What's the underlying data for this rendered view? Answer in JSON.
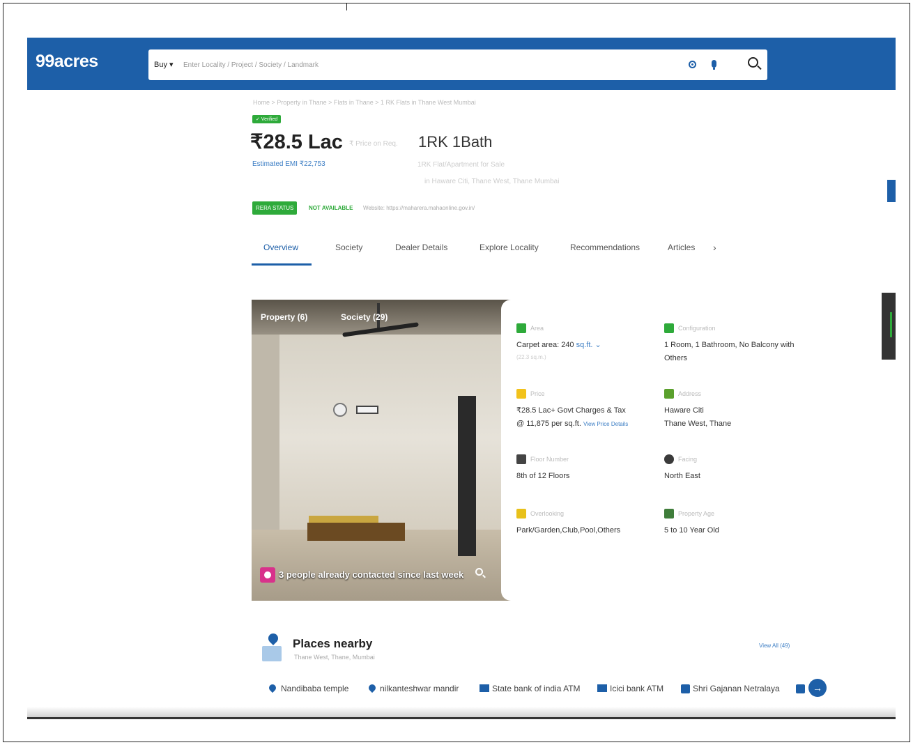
{
  "header": {
    "logo": "99acres",
    "buy_label": "Buy ▾",
    "search_placeholder": "Enter Locality / Project / Society / Landmark"
  },
  "listing": {
    "breadcrumb": "Home > Property in Thane > Flats in Thane > 1 RK Flats in Thane West Mumbai",
    "verified": "✓ Verified",
    "price": "₹28.5 Lac",
    "price_sub": "₹ Price on Req.",
    "config": "1RK 1Bath",
    "emi": "Estimated EMI ₹22,753",
    "subtitle1": "1RK Flat/Apartment for Sale",
    "subtitle2": "in Haware Citi, Thane West, Thane Mumbai",
    "rera_label": "RERA STATUS",
    "rera_status": "NOT AVAILABLE",
    "rera_site": "Website: https://maharera.mahaonline.gov.in/"
  },
  "tabs": [
    {
      "label": "Overview"
    },
    {
      "label": "Society"
    },
    {
      "label": "Dealer Details"
    },
    {
      "label": "Explore Locality"
    },
    {
      "label": "Recommendations"
    },
    {
      "label": "Articles"
    }
  ],
  "gallery": {
    "property_tab": "Property (6)",
    "society_tab": "Society (29)",
    "contact_text": "3 people already contacted since last week"
  },
  "details": {
    "area_label": "Area",
    "area_value": "Carpet area: 240",
    "area_unit": "sq.ft. ⌄",
    "area_sub": "(22.3 sq.m.)",
    "config_label": "Configuration",
    "config_value_1": "1 Room, 1 Bathroom, No Balcony with",
    "config_value_2": "Others",
    "price_label": "Price",
    "price_value_1": "₹28.5 Lac+ Govt Charges & Tax",
    "price_value_2": "@ 11,875 per sq.ft.",
    "price_link": "View Price Details",
    "address_label": "Address",
    "address_value_1": "Haware Citi",
    "address_value_2": "Thane West, Thane",
    "floor_label": "Floor Number",
    "floor_value": "8th  of 12 Floors",
    "facing_label": "Facing",
    "facing_value": "North East",
    "overlooking_label": "Overlooking",
    "overlooking_value": "Park/Garden,Club,Pool,Others",
    "age_label": "Property Age",
    "age_value": "5 to 10 Year Old"
  },
  "places": {
    "title": "Places nearby",
    "subtitle": "Thane West, Thane, Mumbai",
    "view_all": "View All (49)",
    "items": [
      {
        "label": "Nandibaba temple"
      },
      {
        "label": "nilkanteshwar mandir"
      },
      {
        "label": "State bank of india ATM"
      },
      {
        "label": "Icici bank ATM"
      },
      {
        "label": "Shri Gajanan Netralaya"
      }
    ],
    "next": "→"
  },
  "colors": {
    "brand": "#1d5fa8",
    "verified_green": "#2eaa3a",
    "contact_pink": "#d8328b"
  }
}
